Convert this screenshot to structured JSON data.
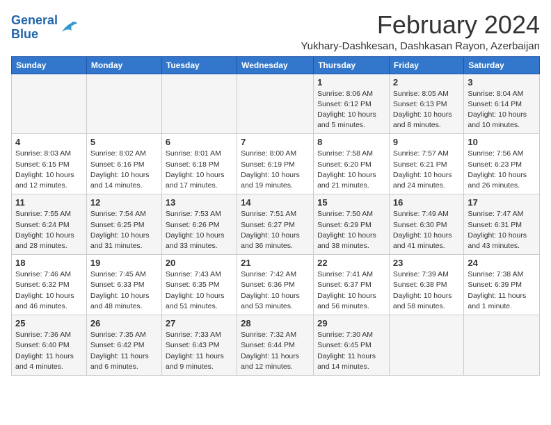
{
  "logo": {
    "line1": "General",
    "line2": "Blue"
  },
  "title": "February 2024",
  "location": "Yukhary-Dashkesan, Dashkasan Rayon, Azerbaijan",
  "days_of_week": [
    "Sunday",
    "Monday",
    "Tuesday",
    "Wednesday",
    "Thursday",
    "Friday",
    "Saturday"
  ],
  "weeks": [
    [
      {
        "day": "",
        "info": ""
      },
      {
        "day": "",
        "info": ""
      },
      {
        "day": "",
        "info": ""
      },
      {
        "day": "",
        "info": ""
      },
      {
        "day": "1",
        "info": "Sunrise: 8:06 AM\nSunset: 6:12 PM\nDaylight: 10 hours\nand 5 minutes."
      },
      {
        "day": "2",
        "info": "Sunrise: 8:05 AM\nSunset: 6:13 PM\nDaylight: 10 hours\nand 8 minutes."
      },
      {
        "day": "3",
        "info": "Sunrise: 8:04 AM\nSunset: 6:14 PM\nDaylight: 10 hours\nand 10 minutes."
      }
    ],
    [
      {
        "day": "4",
        "info": "Sunrise: 8:03 AM\nSunset: 6:15 PM\nDaylight: 10 hours\nand 12 minutes."
      },
      {
        "day": "5",
        "info": "Sunrise: 8:02 AM\nSunset: 6:16 PM\nDaylight: 10 hours\nand 14 minutes."
      },
      {
        "day": "6",
        "info": "Sunrise: 8:01 AM\nSunset: 6:18 PM\nDaylight: 10 hours\nand 17 minutes."
      },
      {
        "day": "7",
        "info": "Sunrise: 8:00 AM\nSunset: 6:19 PM\nDaylight: 10 hours\nand 19 minutes."
      },
      {
        "day": "8",
        "info": "Sunrise: 7:58 AM\nSunset: 6:20 PM\nDaylight: 10 hours\nand 21 minutes."
      },
      {
        "day": "9",
        "info": "Sunrise: 7:57 AM\nSunset: 6:21 PM\nDaylight: 10 hours\nand 24 minutes."
      },
      {
        "day": "10",
        "info": "Sunrise: 7:56 AM\nSunset: 6:23 PM\nDaylight: 10 hours\nand 26 minutes."
      }
    ],
    [
      {
        "day": "11",
        "info": "Sunrise: 7:55 AM\nSunset: 6:24 PM\nDaylight: 10 hours\nand 28 minutes."
      },
      {
        "day": "12",
        "info": "Sunrise: 7:54 AM\nSunset: 6:25 PM\nDaylight: 10 hours\nand 31 minutes."
      },
      {
        "day": "13",
        "info": "Sunrise: 7:53 AM\nSunset: 6:26 PM\nDaylight: 10 hours\nand 33 minutes."
      },
      {
        "day": "14",
        "info": "Sunrise: 7:51 AM\nSunset: 6:27 PM\nDaylight: 10 hours\nand 36 minutes."
      },
      {
        "day": "15",
        "info": "Sunrise: 7:50 AM\nSunset: 6:29 PM\nDaylight: 10 hours\nand 38 minutes."
      },
      {
        "day": "16",
        "info": "Sunrise: 7:49 AM\nSunset: 6:30 PM\nDaylight: 10 hours\nand 41 minutes."
      },
      {
        "day": "17",
        "info": "Sunrise: 7:47 AM\nSunset: 6:31 PM\nDaylight: 10 hours\nand 43 minutes."
      }
    ],
    [
      {
        "day": "18",
        "info": "Sunrise: 7:46 AM\nSunset: 6:32 PM\nDaylight: 10 hours\nand 46 minutes."
      },
      {
        "day": "19",
        "info": "Sunrise: 7:45 AM\nSunset: 6:33 PM\nDaylight: 10 hours\nand 48 minutes."
      },
      {
        "day": "20",
        "info": "Sunrise: 7:43 AM\nSunset: 6:35 PM\nDaylight: 10 hours\nand 51 minutes."
      },
      {
        "day": "21",
        "info": "Sunrise: 7:42 AM\nSunset: 6:36 PM\nDaylight: 10 hours\nand 53 minutes."
      },
      {
        "day": "22",
        "info": "Sunrise: 7:41 AM\nSunset: 6:37 PM\nDaylight: 10 hours\nand 56 minutes."
      },
      {
        "day": "23",
        "info": "Sunrise: 7:39 AM\nSunset: 6:38 PM\nDaylight: 10 hours\nand 58 minutes."
      },
      {
        "day": "24",
        "info": "Sunrise: 7:38 AM\nSunset: 6:39 PM\nDaylight: 11 hours\nand 1 minute."
      }
    ],
    [
      {
        "day": "25",
        "info": "Sunrise: 7:36 AM\nSunset: 6:40 PM\nDaylight: 11 hours\nand 4 minutes."
      },
      {
        "day": "26",
        "info": "Sunrise: 7:35 AM\nSunset: 6:42 PM\nDaylight: 11 hours\nand 6 minutes."
      },
      {
        "day": "27",
        "info": "Sunrise: 7:33 AM\nSunset: 6:43 PM\nDaylight: 11 hours\nand 9 minutes."
      },
      {
        "day": "28",
        "info": "Sunrise: 7:32 AM\nSunset: 6:44 PM\nDaylight: 11 hours\nand 12 minutes."
      },
      {
        "day": "29",
        "info": "Sunrise: 7:30 AM\nSunset: 6:45 PM\nDaylight: 11 hours\nand 14 minutes."
      },
      {
        "day": "",
        "info": ""
      },
      {
        "day": "",
        "info": ""
      }
    ]
  ]
}
